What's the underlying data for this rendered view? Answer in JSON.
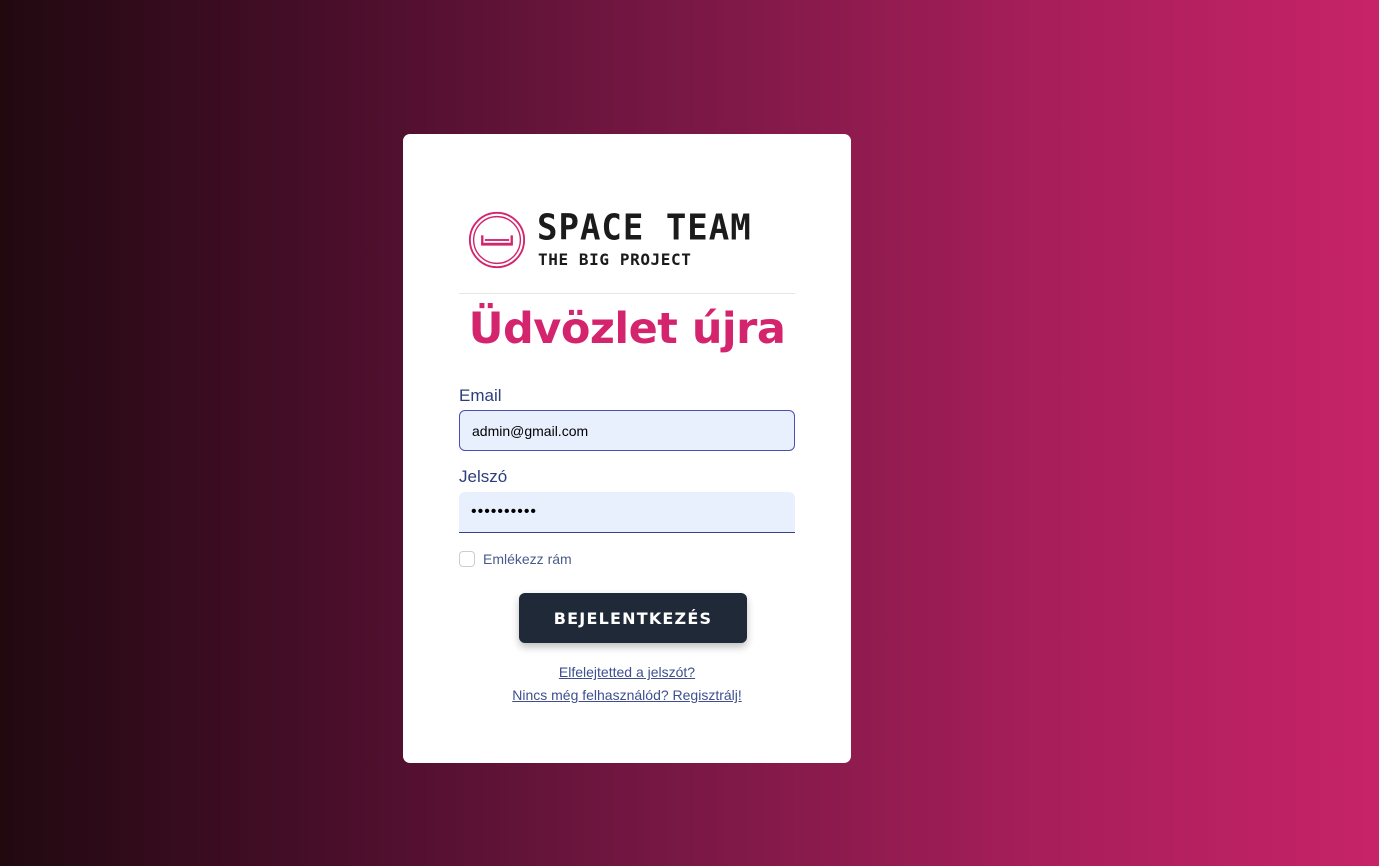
{
  "brand": {
    "title": "SPACE TEAM",
    "subtitle": "THE BIG PROJECT",
    "accent_color": "#d4246e"
  },
  "login": {
    "heading": "Üdvözlet újra",
    "email_label": "Email",
    "email_value": "admin@gmail.com",
    "password_label": "Jelszó",
    "password_value": "••••••••••",
    "remember_label": "Emlékezz rám",
    "remember_checked": false,
    "submit_label": "BEJELENTKEZÉS",
    "forgot_link": "Elfelejtetted a jelszót?",
    "register_link": "Nincs még felhasználód? Regisztrálj!"
  },
  "icons": [
    "logo-ring-icon"
  ]
}
